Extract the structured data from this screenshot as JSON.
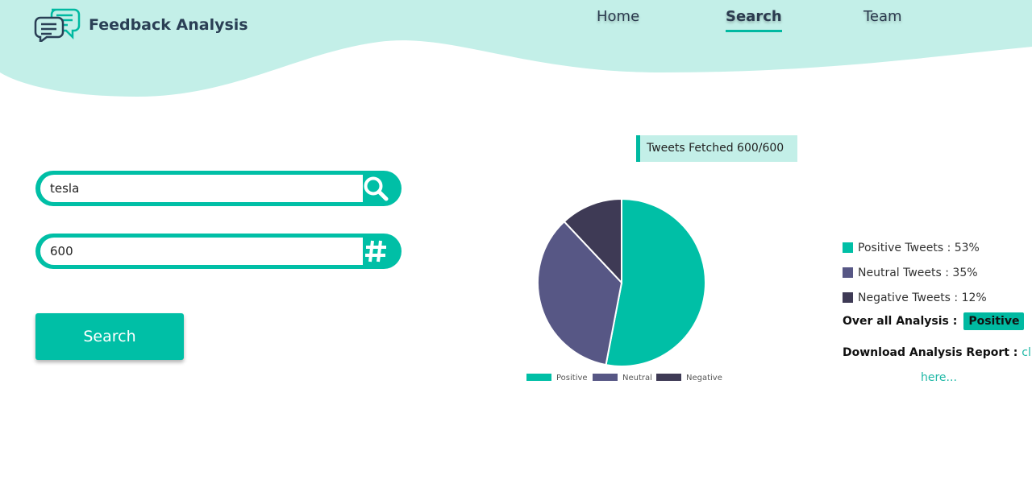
{
  "header": {
    "brand": "Feedback Analysis",
    "logo_icon": "chat-bubbles-icon",
    "nav": [
      {
        "label": "Home",
        "active": false
      },
      {
        "label": "Search",
        "active": true
      },
      {
        "label": "Team",
        "active": false
      }
    ],
    "colors": {
      "header_bg": "#c3efe8",
      "accent": "#00b9a1"
    }
  },
  "search": {
    "query_value": "tesla",
    "query_icon": "search-icon",
    "count_value": "600",
    "count_icon": "hash-icon",
    "button_label": "Search"
  },
  "status": {
    "fetched_label": "Tweets Fetched 600/600"
  },
  "chart_data": {
    "type": "pie",
    "categories": [
      "Positive",
      "Neutral",
      "Negative"
    ],
    "values": [
      53,
      35,
      12
    ],
    "colors": [
      "#00bfa6",
      "#575785",
      "#3e3a55"
    ],
    "legend_position": "bottom"
  },
  "summary": {
    "items": [
      {
        "label": "Positive Tweets : 53%",
        "color": "#00bfa6"
      },
      {
        "label": "Neutral Tweets : 35%",
        "color": "#575785"
      },
      {
        "label": "Negative Tweets : 12%",
        "color": "#3e3a55"
      }
    ],
    "overall_label": "Over all Analysis :",
    "overall_value": "Positive",
    "download_label": "Download Analysis Report :",
    "download_link_1": "click",
    "download_link_2": "here..."
  }
}
